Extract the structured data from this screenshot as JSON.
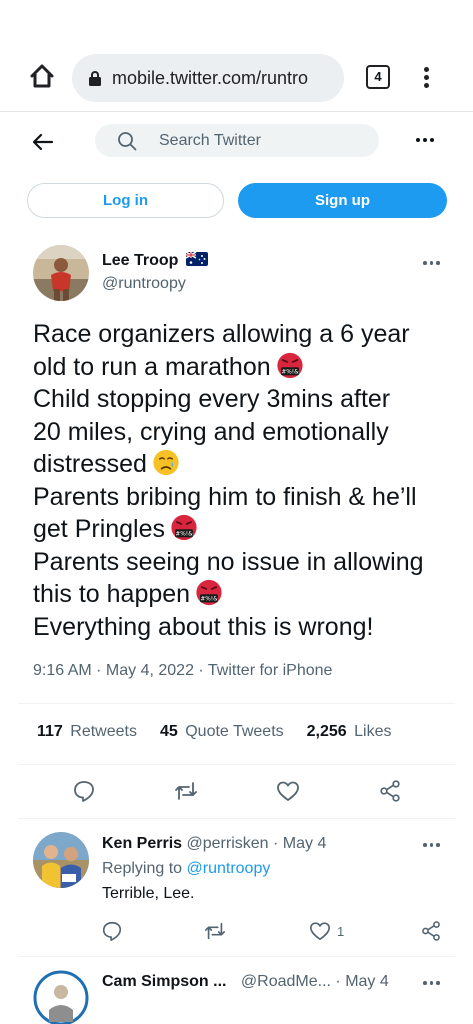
{
  "browser": {
    "url": "mobile.twitter.com/runtro",
    "tab_count": "4"
  },
  "header": {
    "search_placeholder": "Search Twitter"
  },
  "auth": {
    "login_label": "Log in",
    "signup_label": "Sign up"
  },
  "tweet": {
    "author_name": "Lee Troop",
    "author_handle": "@runtroopy",
    "text_lines": [
      "Race organizers allowing a 6 year",
      "old to run a marathon",
      "Child stopping every 3mins after",
      "20 miles, crying and emotionally",
      "distressed",
      "Parents bribing him to finish & he’ll",
      "get Pringles",
      "Parents seeing no issue in allowing",
      "this to happen",
      "Everything about this is wrong!"
    ],
    "meta": "9:16 AM · May 4, 2022 · Twitter for iPhone",
    "retweets_count": "117",
    "retweets_label": "Retweets",
    "quotes_count": "45",
    "quotes_label": "Quote Tweets",
    "likes_count": "2,256",
    "likes_label": "Likes"
  },
  "replies": [
    {
      "name": "Ken Perris",
      "handle": "@perrisken · May 4",
      "replying_prefix": "Replying to",
      "replying_to": "@runtroopy",
      "text": "Terrible, Lee.",
      "like_count": "1"
    },
    {
      "name": "Cam Simpson ...",
      "handle": "@RoadMe... · May 4"
    }
  ],
  "colors": {
    "accent": "#1d9bf0",
    "text_primary": "#0f1419",
    "text_secondary": "#536471"
  }
}
